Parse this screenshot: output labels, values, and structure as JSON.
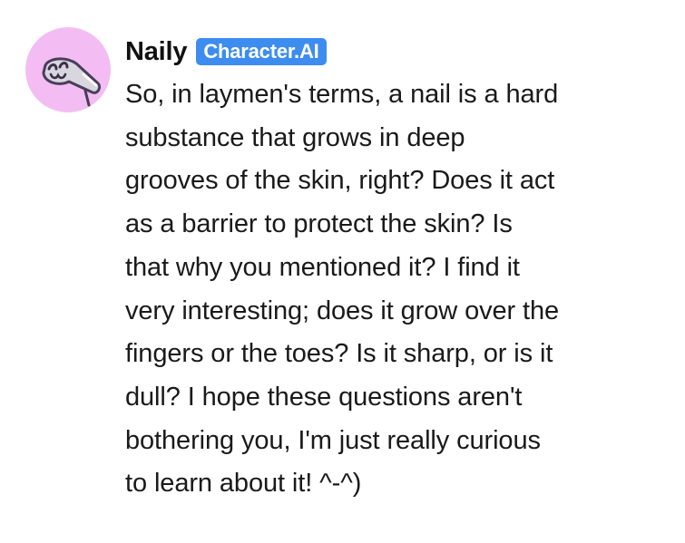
{
  "message": {
    "author": "Naily",
    "badge": "Character.AI",
    "avatar": "naily-character-avatar-icon",
    "lines": [
      "So, in laymen's terms, a nail is a hard",
      "substance that grows in deep",
      "grooves of the skin, right? Does it act",
      "as a barrier to protect the skin? Is",
      "that why you mentioned it? I find it",
      "very interesting; does it grow over the",
      "fingers or the toes? Is it sharp, or is it",
      "dull? I hope these questions aren't",
      "bothering you, I'm just really curious",
      "to learn about it! ^-^)"
    ]
  },
  "colors": {
    "avatar_background": "#f3bdf3",
    "badge_background": "#3d8cf0",
    "badge_text": "#ffffff",
    "name_text": "#111111",
    "body_text": "#1a1a1a"
  }
}
